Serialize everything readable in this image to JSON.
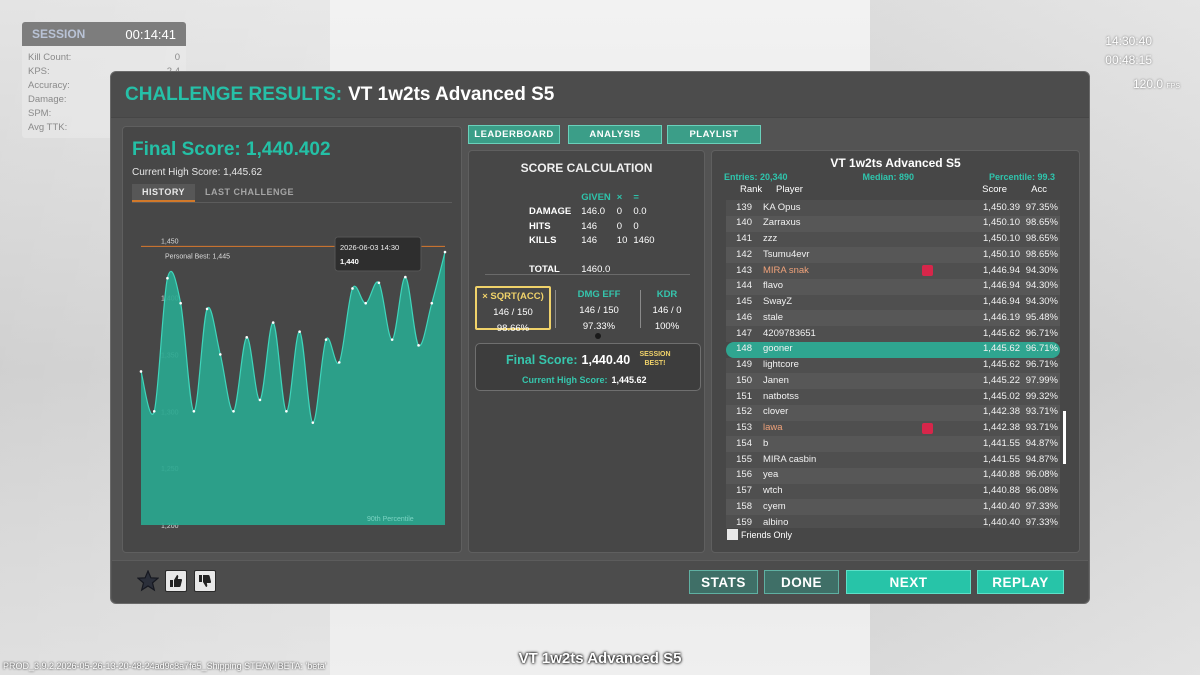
{
  "session": {
    "label": "SESSION",
    "time": "00:14:41",
    "rows": [
      {
        "label": "Kill Count:",
        "value": "0"
      },
      {
        "label": "KPS:",
        "value": "2.4"
      },
      {
        "label": "Accuracy:",
        "value": "146/150 (97.3%)"
      },
      {
        "label": "Damage:",
        "value": "146/150 (97.3%)"
      },
      {
        "label": "SPM:",
        "value": "0"
      },
      {
        "label": "Avg TTK:",
        "value": "0.420s"
      }
    ]
  },
  "hud": {
    "clock": "14:30:40",
    "elapsed": "00:48:15",
    "fps_value": "120.0",
    "fps_unit": "FPS"
  },
  "dialog": {
    "title_prefix": "CHALLENGE RESULTS:",
    "title_name": "VT 1w2ts Advanced S5"
  },
  "left": {
    "final_score_label": "Final Score: 1,440.402",
    "current_high": "Current High Score: 1,445.62",
    "tabs": [
      "HISTORY",
      "LAST CHALLENGE"
    ]
  },
  "history_chart": {
    "y_ticks": [
      "1,450",
      "1,400",
      "1,350",
      "1,300",
      "1,250",
      "1,200"
    ],
    "personal_best_label": "Personal Best: 1,445",
    "tooltip_date": "2026-06-03 14:30",
    "tooltip_value": "1,440",
    "percentile_label": "90th Percentile"
  },
  "chart_data": {
    "type": "area",
    "ylim": [
      1200,
      1455
    ],
    "personal_best": 1445,
    "values": [
      1335,
      1300,
      1417,
      1395,
      1300,
      1390,
      1350,
      1300,
      1365,
      1310,
      1378,
      1300,
      1370,
      1290,
      1363,
      1343,
      1408,
      1395,
      1413,
      1363,
      1418,
      1358,
      1395,
      1440
    ]
  },
  "top_buttons": [
    "LEADERBOARD",
    "ANALYSIS",
    "PLAYLIST"
  ],
  "score_calc": {
    "title": "SCORE CALCULATION",
    "hdr": [
      "GIVEN",
      "×",
      "="
    ],
    "rows": [
      {
        "label": "DAMAGE",
        "a": "146.0",
        "b": "0",
        "c": "0.0"
      },
      {
        "label": "HITS",
        "a": "146",
        "b": "0",
        "c": "0"
      },
      {
        "label": "KILLS",
        "a": "146",
        "b": "10",
        "c": "1460"
      }
    ],
    "total_label": "TOTAL",
    "total_value": "1460.0",
    "metrics": [
      {
        "title": "× SQRT(ACC)",
        "value": "146 / 150",
        "pct": "98.66%"
      },
      {
        "title": "DMG EFF",
        "value": "146 / 150",
        "pct": "97.33%"
      },
      {
        "title": "KDR",
        "value": "146 / 0",
        "pct": "100%"
      }
    ],
    "final_label": "Final Score:",
    "final_value": "1,440.40",
    "session_best": "SESSION BEST!",
    "high_label": "Current High Score:",
    "high_value": "1,445.62"
  },
  "leaderboard": {
    "title": "VT 1w2ts Advanced S5",
    "entries": "Entries: 20,340",
    "median": "Median: 890",
    "percentile": "Percentile: 99.3",
    "col_rank": "Rank",
    "col_player": "Player",
    "col_score": "Score",
    "col_acc": "Acc",
    "rows": [
      {
        "rank": "139",
        "player": "KA Opus",
        "score": "1,450.39",
        "acc": "97.35%"
      },
      {
        "rank": "140",
        "player": "Zarraxus",
        "score": "1,450.10",
        "acc": "98.65%"
      },
      {
        "rank": "141",
        "player": "zzz",
        "score": "1,450.10",
        "acc": "98.65%"
      },
      {
        "rank": "142",
        "player": "Tsumu4evr",
        "score": "1,450.10",
        "acc": "98.65%"
      },
      {
        "rank": "143",
        "player": "MIRA snak",
        "score": "1,446.94",
        "acc": "94.30%",
        "mira": true
      },
      {
        "rank": "144",
        "player": "flavo",
        "score": "1,446.94",
        "acc": "94.30%"
      },
      {
        "rank": "145",
        "player": "SwayZ",
        "score": "1,446.94",
        "acc": "94.30%"
      },
      {
        "rank": "146",
        "player": "stale",
        "score": "1,446.19",
        "acc": "95.48%"
      },
      {
        "rank": "147",
        "player": "4209783651",
        "score": "1,445.62",
        "acc": "96.71%"
      },
      {
        "rank": "148",
        "player": "gooner",
        "score": "1,445.62",
        "acc": "96.71%",
        "self": true
      },
      {
        "rank": "149",
        "player": "lightcore",
        "score": "1,445.62",
        "acc": "96.71%"
      },
      {
        "rank": "150",
        "player": "Janen",
        "score": "1,445.22",
        "acc": "97.99%"
      },
      {
        "rank": "151",
        "player": "natbotss",
        "score": "1,445.02",
        "acc": "99.32%"
      },
      {
        "rank": "152",
        "player": "clover",
        "score": "1,442.38",
        "acc": "93.71%"
      },
      {
        "rank": "153",
        "player": "lawa",
        "score": "1,442.38",
        "acc": "93.71%",
        "mira": true
      },
      {
        "rank": "154",
        "player": "b",
        "score": "1,441.55",
        "acc": "94.87%"
      },
      {
        "rank": "155",
        "player": "MIRA casbin",
        "score": "1,441.55",
        "acc": "94.87%"
      },
      {
        "rank": "156",
        "player": "yea",
        "score": "1,440.88",
        "acc": "96.08%"
      },
      {
        "rank": "157",
        "player": "wtch",
        "score": "1,440.88",
        "acc": "96.08%"
      },
      {
        "rank": "158",
        "player": "cyem",
        "score": "1,440.40",
        "acc": "97.33%"
      },
      {
        "rank": "159",
        "player": "albino",
        "score": "1,440.40",
        "acc": "97.33%"
      }
    ],
    "friends_only": "Friends Only"
  },
  "bottom": {
    "stats": "STATS",
    "done": "DONE",
    "next": "NEXT",
    "replay": "REPLAY"
  },
  "footer_title": "VT 1w2ts Advanced S5",
  "build": "PROD_3.9.2.2026-05-26-13-20-48-24ad9c8a7fe5_Shipping STEAM BETA: 'beta'"
}
